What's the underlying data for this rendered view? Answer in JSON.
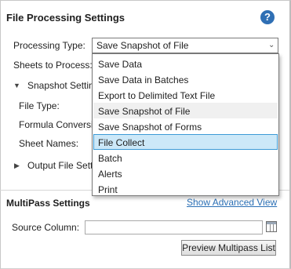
{
  "panel": {
    "title": "File Processing Settings",
    "help_icon": "?",
    "processing_type_label": "Processing Type:",
    "processing_type_value": "Save Snapshot of File",
    "sheets_label": "Sheets to Process:",
    "snapshot_settings_label": "Snapshot Settin",
    "file_type_label": "File Type:",
    "formula_label": "Formula Conversi",
    "sheet_names_label": "Sheet Names:",
    "output_settings_label": "Output File Sett"
  },
  "dropdown": {
    "options": [
      {
        "label": "Save Data"
      },
      {
        "label": "Save Data in Batches"
      },
      {
        "label": "Export to Delimited Text File"
      },
      {
        "label": "Save Snapshot of File",
        "state": "current"
      },
      {
        "label": "Save Snapshot of Forms"
      },
      {
        "label": "File Collect",
        "state": "hover"
      },
      {
        "label": "Batch"
      },
      {
        "label": "Alerts"
      },
      {
        "label": "Print"
      }
    ]
  },
  "multipass": {
    "title": "MultiPass Settings",
    "advanced_link": "Show Advanced View",
    "source_column_label": "Source Column:",
    "source_column_value": "",
    "preview_button": "Preview Multipass List"
  },
  "colors": {
    "accent": "#2f6fb4",
    "link": "#2a6fb5",
    "hover_bg": "#cce8f8",
    "hover_border": "#3c9ad6",
    "error_edge": "#e03030"
  },
  "icons": {
    "help": "help-icon",
    "chevron": "chevron-down-icon",
    "expander": "expander-chevron-icon",
    "table_picker": "table-picker-icon"
  }
}
